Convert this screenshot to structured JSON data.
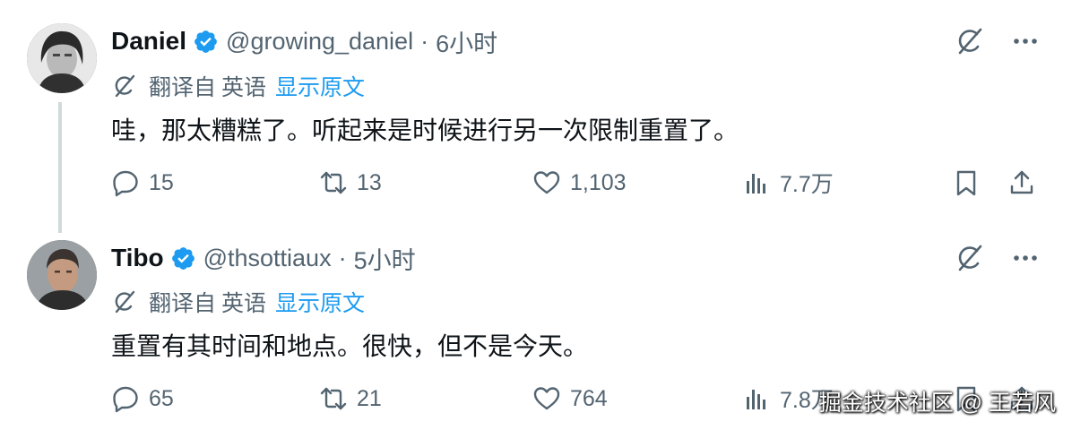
{
  "tweets": [
    {
      "author": {
        "name": "Daniel",
        "handle": "@growing_daniel",
        "verified": true
      },
      "time": "6小时",
      "translation": {
        "label": "翻译自",
        "language": "英语",
        "show_original": "显示原文"
      },
      "text": "哇，那太糟糕了。听起来是时候进行另一次限制重置了。",
      "stats": {
        "replies": "15",
        "retweets": "13",
        "likes": "1,103",
        "views": "7.7万"
      }
    },
    {
      "author": {
        "name": "Tibo",
        "handle": "@thsottiaux",
        "verified": true
      },
      "time": "5小时",
      "translation": {
        "label": "翻译自",
        "language": "英语",
        "show_original": "显示原文"
      },
      "text": "重置有其时间和地点。很快，但不是今天。",
      "stats": {
        "replies": "65",
        "retweets": "21",
        "likes": "764",
        "views": "7.8万"
      }
    }
  ],
  "separator": "·",
  "watermark": "掘金技术社区 @ 王若风",
  "colors": {
    "text": "#0f1419",
    "secondary": "#536471",
    "link": "#1d9bf0",
    "verified": "#1d9bf0",
    "thread_line": "#cfd9de"
  },
  "icons": [
    "verified-badge-icon",
    "grok-icon",
    "more-icon",
    "translate-icon",
    "reply-icon",
    "retweet-icon",
    "like-icon",
    "views-icon",
    "bookmark-icon",
    "share-icon"
  ]
}
